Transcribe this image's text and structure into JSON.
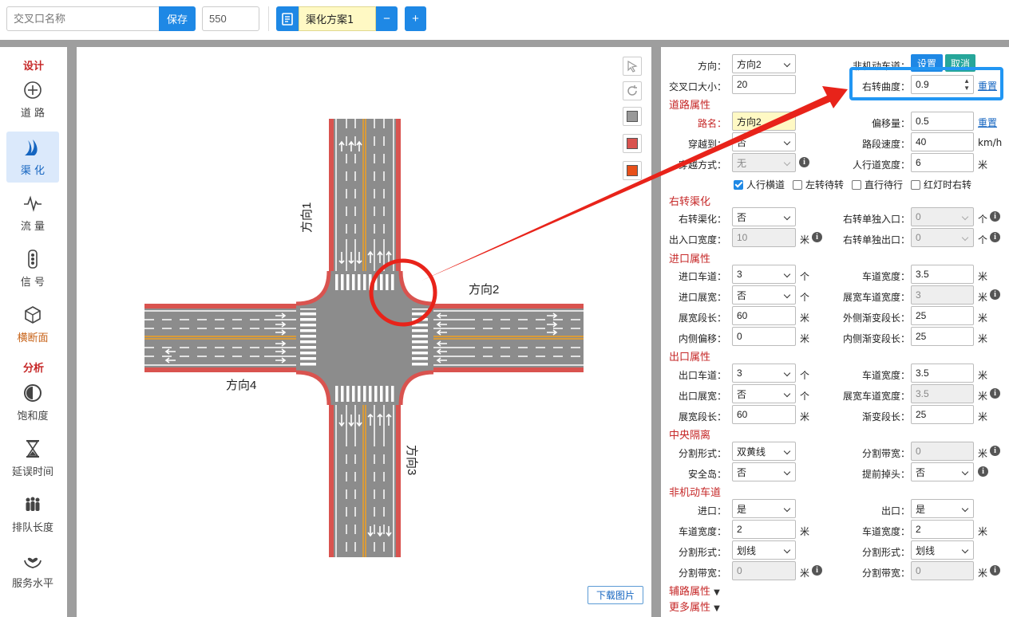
{
  "topbar": {
    "name_placeholder": "交叉口名称",
    "save_label": "保存",
    "number_value": "550",
    "scheme_name": "渠化方案1",
    "minus_label": "−",
    "plus_label": "+"
  },
  "sidebar": {
    "section_design": "设计",
    "section_analysis": "分析",
    "items": [
      {
        "label": "道 路",
        "icon": "crosshair-icon"
      },
      {
        "label": "渠 化",
        "icon": "channel-icon"
      },
      {
        "label": "流 量",
        "icon": "pulse-icon"
      },
      {
        "label": "信 号",
        "icon": "traffic-light-icon"
      },
      {
        "label": "横断面",
        "icon": "cube-icon"
      },
      {
        "label": "饱和度",
        "icon": "half-circle-icon"
      },
      {
        "label": "延误时间",
        "icon": "hourglass-icon"
      },
      {
        "label": "排队长度",
        "icon": "people-icon"
      },
      {
        "label": "服务水平",
        "icon": "hand-heart-icon"
      }
    ]
  },
  "canvas": {
    "dir1": "方向1",
    "dir2": "方向2",
    "dir3": "方向3",
    "dir4": "方向4",
    "download_label": "下载图片",
    "colors": {
      "road": "#888888",
      "edge": "#d9534f",
      "center": "#f0a020"
    }
  },
  "panel": {
    "direction_label": "方向：",
    "direction_value": "方向2",
    "nonmotor_label": "非机动车道：",
    "set_label": "设置",
    "cancel_label": "取消",
    "size_label": "交叉口大小：",
    "size_value": "20",
    "curve_label": "右转曲度：",
    "curve_value": "0.9",
    "reset_label": "重置",
    "road_section": "道路属性",
    "road_name_label": "路名：",
    "road_name_value": "方向2",
    "offset_label": "偏移量：",
    "offset_value": "0.5",
    "cross_label": "穿越到：",
    "cross_value": "否",
    "speed_label": "路段速度：",
    "speed_value": "40",
    "speed_unit": "km/h",
    "cross_mode_label": "穿越方式：",
    "cross_mode_value": "无",
    "sidewalk_label": "人行道宽度：",
    "sidewalk_value": "6",
    "unit_m": "米",
    "unit_count": "个",
    "cb_crosswalk": "人行横道",
    "cb_left_wait": "左转待转",
    "cb_straight_wait": "直行待行",
    "cb_red_right": "红灯时右转",
    "right_section": "右转渠化",
    "right_ch_label": "右转渠化：",
    "right_ch_value": "否",
    "right_entry_label": "右转单独入口：",
    "right_entry_value": "0",
    "io_width_label": "出入口宽度：",
    "io_width_value": "10",
    "right_exit_label": "右转单独出口：",
    "right_exit_value": "0",
    "entry_section": "进口属性",
    "entry_lanes_label": "进口车道：",
    "entry_lanes_value": "3",
    "lane_width_label": "车道宽度：",
    "entry_lane_width": "3.5",
    "entry_widen_label": "进口展宽：",
    "entry_widen_value": "否",
    "widen_lane_width_label": "展宽车道宽度：",
    "entry_widen_lane_width": "3",
    "widen_len_label": "展宽段长：",
    "entry_widen_len": "60",
    "outer_taper_label": "外侧渐变段长：",
    "outer_taper_value": "25",
    "inner_offset_label": "内侧偏移：",
    "inner_offset_value": "0",
    "inner_taper_label": "内侧渐变段长：",
    "inner_taper_value": "25",
    "exit_section": "出口属性",
    "exit_lanes_label": "出口车道：",
    "exit_lanes_value": "3",
    "exit_lane_width": "3.5",
    "exit_widen_label": "出口展宽：",
    "exit_widen_value": "否",
    "exit_widen_lane_width": "3.5",
    "exit_widen_len": "60",
    "taper_label": "渐变段长：",
    "exit_taper_value": "25",
    "median_section": "中央隔离",
    "split_form_label": "分割形式：",
    "median_form_value": "双黄线",
    "split_width_label": "分割带宽：",
    "median_width_value": "0",
    "island_label": "安全岛：",
    "island_value": "否",
    "uturn_label": "提前掉头：",
    "uturn_value": "否",
    "nonmotor_section": "非机动车道",
    "in_label": "进口：",
    "in_value": "是",
    "out_label": "出口：",
    "out_value": "是",
    "nm_in_width": "2",
    "nm_out_width": "2",
    "nm_in_form": "划线",
    "nm_out_form": "划线",
    "nm_in_split": "0",
    "nm_out_split": "0",
    "aux_section": "辅路属性",
    "more_section": "更多属性"
  }
}
